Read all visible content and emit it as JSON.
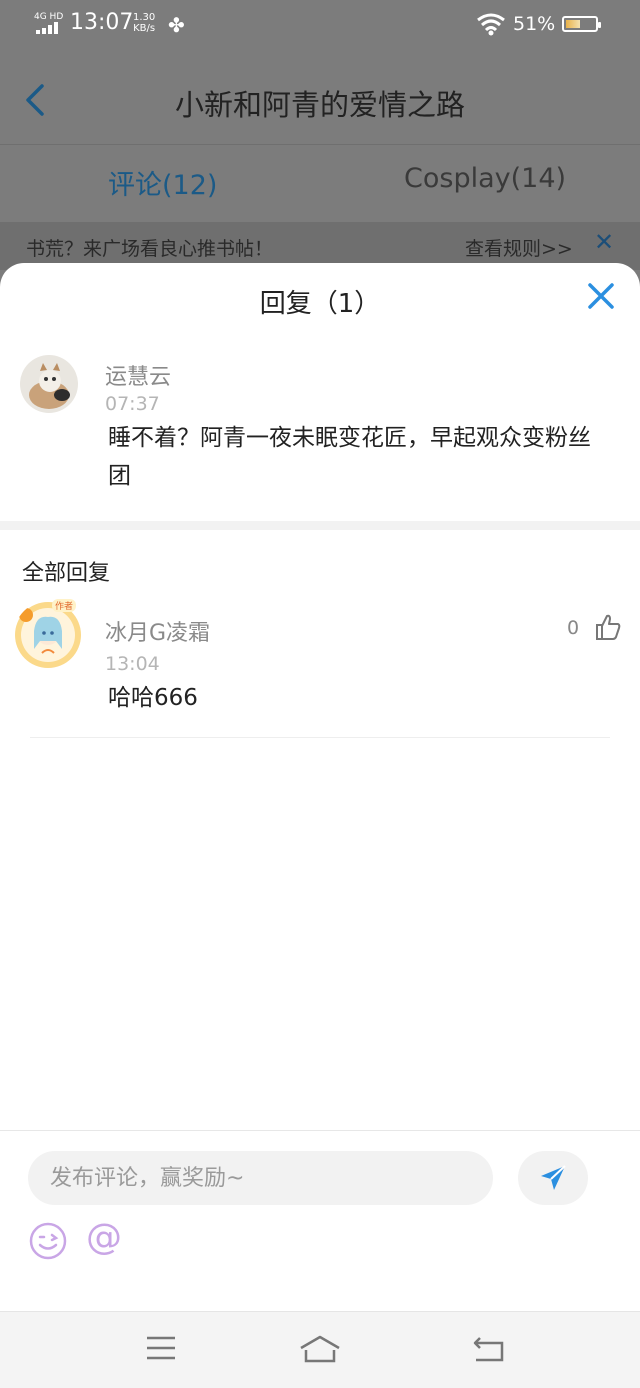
{
  "status_bar": {
    "network": "4G HD",
    "time": "13:07",
    "speed_value": "1.30",
    "speed_unit": "KB/s",
    "battery_percent": "51%",
    "battery_level": 0.51
  },
  "header": {
    "title": "小新和阿青的爱情之路"
  },
  "tabs": [
    {
      "label": "评论(12)",
      "active": true
    },
    {
      "label": "Cosplay(14)",
      "active": false
    }
  ],
  "notice": {
    "text": "书荒？来广场看良心推书帖！",
    "link": "查看规则>>"
  },
  "sheet": {
    "title": "回复（1）",
    "main_comment": {
      "user": "运慧云",
      "time": "07:37",
      "content": "睡不着？阿青一夜未眠变花匠，早起观众变粉丝团"
    },
    "section_title": "全部回复",
    "replies": [
      {
        "user": "冰月G凌霜",
        "time": "13:04",
        "content": "哈哈666",
        "likes": "0",
        "badge": "作者"
      }
    ]
  },
  "input_bar": {
    "placeholder": "发布评论，赢奖励~"
  },
  "colors": {
    "accent": "#2b8fe0",
    "tab_active": "#1b5a87",
    "overlay": "#7c7c7c"
  },
  "icons": [
    "back-icon",
    "close-icon",
    "like-icon",
    "send-icon",
    "emoji-icon",
    "at-icon",
    "menu-icon",
    "home-icon",
    "return-icon"
  ]
}
